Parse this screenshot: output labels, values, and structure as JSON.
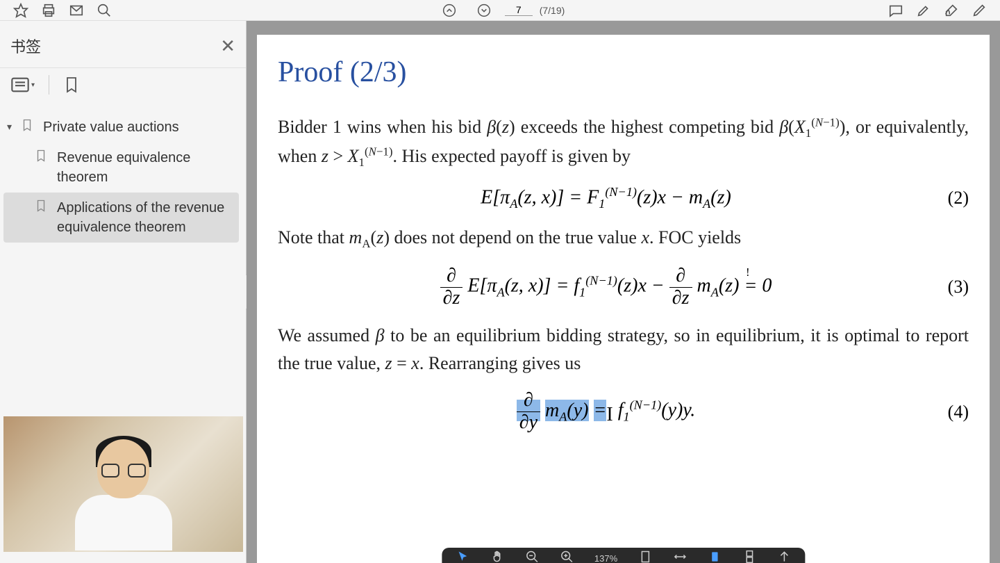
{
  "toolbar": {
    "current_page": "7",
    "total_pages": "(7/19)"
  },
  "sidebar": {
    "title": "书签",
    "tree": {
      "parent": {
        "label": "Private value auctions"
      },
      "children": [
        {
          "label": "Revenue equivalence theorem"
        },
        {
          "label": "Applications of the revenue equivalence theorem"
        }
      ]
    }
  },
  "document": {
    "title": "Proof (2/3)",
    "para1_a": "Bidder 1 wins when his bid ",
    "para1_b": " exceeds the highest competing bid ",
    "para1_c": ", or equivalently, when ",
    "para1_d": ". His expected payoff is given by",
    "eq2_num": "(2)",
    "para2_a": "Note that ",
    "para2_b": " does not depend on the true value ",
    "para2_c": ". FOC yields",
    "eq3_num": "(3)",
    "para3_a": "We assumed ",
    "para3_b": " to be an equilibrium bidding strategy, so in equilibrium, it is optimal to report the true value, ",
    "para3_c": ". Rearranging gives us",
    "eq4_num": "(4)"
  },
  "bottom_bar": {
    "zoom": "137%"
  }
}
